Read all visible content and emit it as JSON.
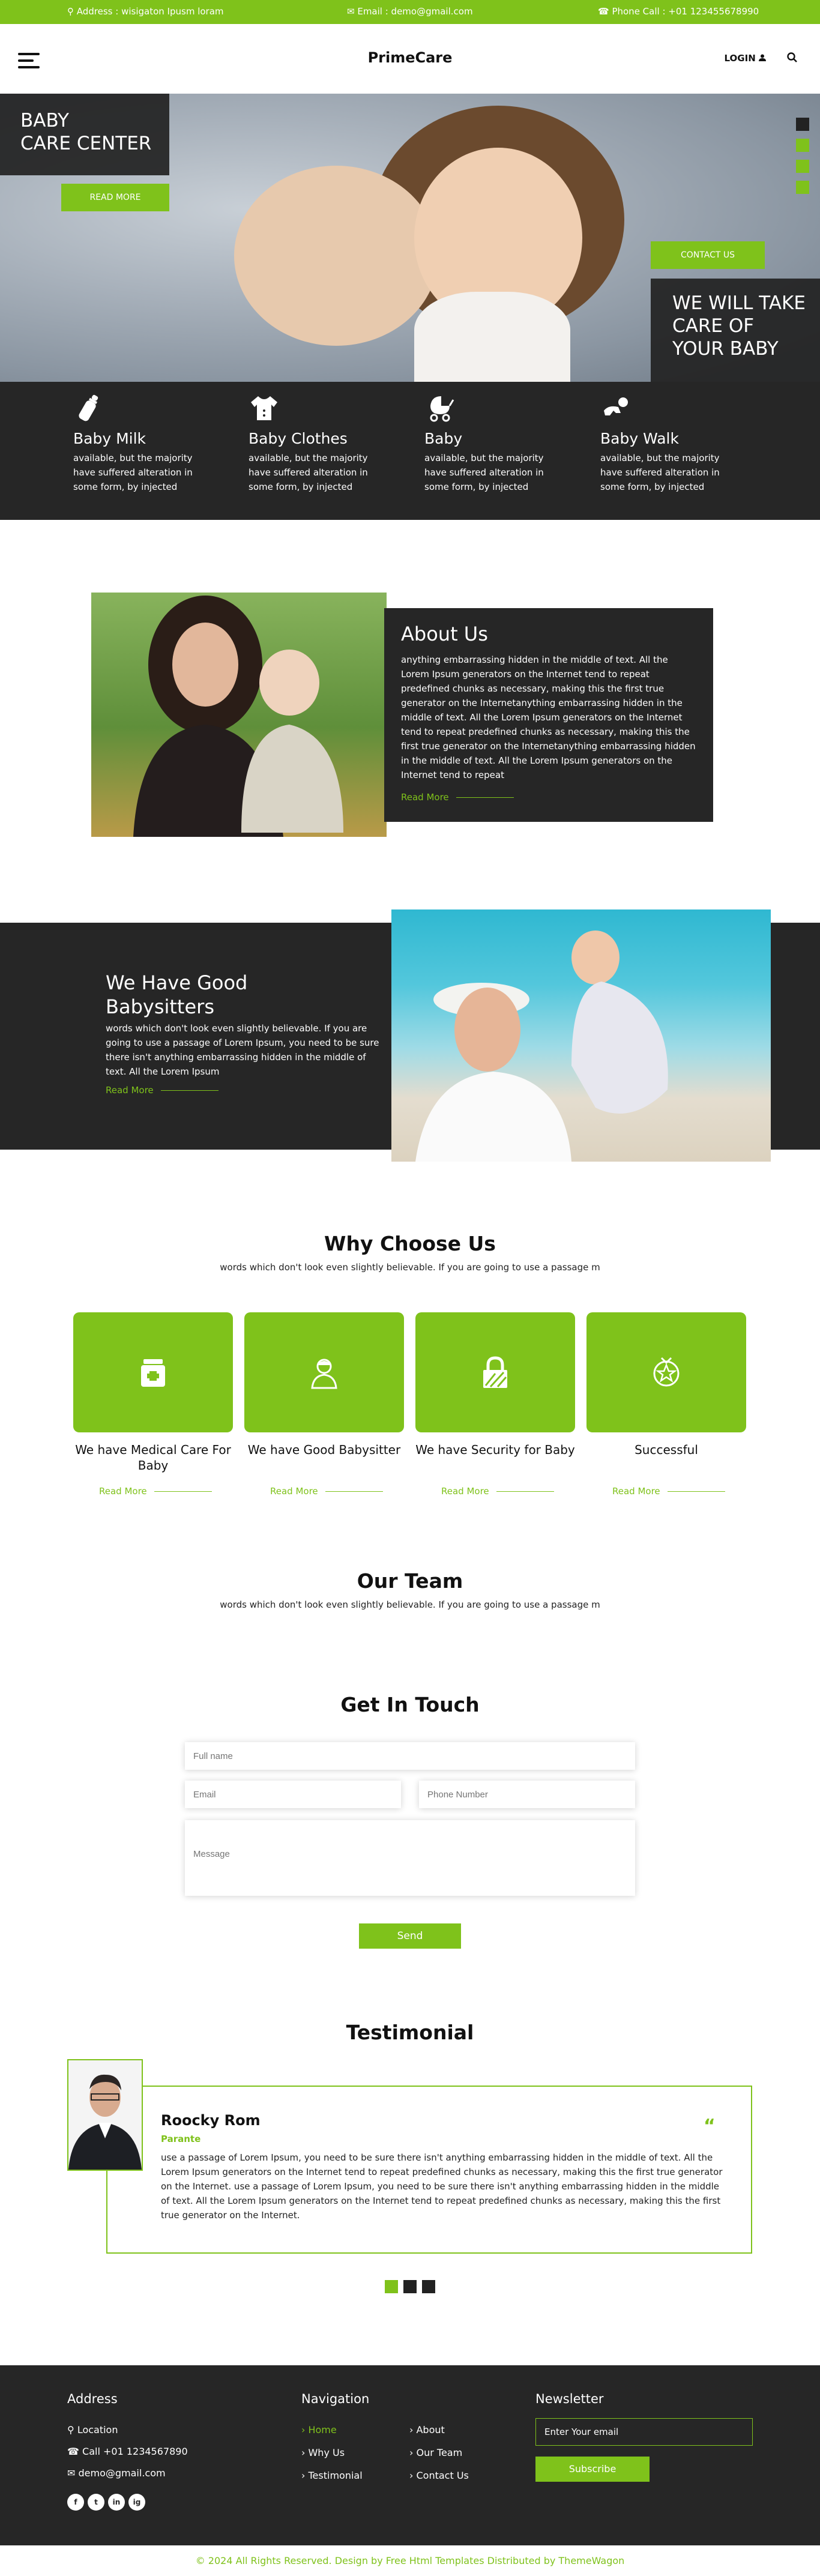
{
  "topbar": {
    "address": "Address : wisigaton Ipusm loram",
    "email": "Email : demo@gmail.com",
    "phone": "Phone Call : +01 123455678990"
  },
  "header": {
    "logo": "PrimeCare",
    "login": "LOGIN"
  },
  "hero": {
    "title_line1": "BABY",
    "title_line2": "CARE CENTER",
    "read_more": "READ MORE",
    "contact": "CONTACT US",
    "tag_line1": "WE WILL TAKE",
    "tag_line2": "CARE OF",
    "tag_line3": "YOUR BABY"
  },
  "features": [
    {
      "title": "Baby Milk",
      "text": "available, but the majority have suffered alteration in some form, by injected",
      "icon": "milk-bottle-icon"
    },
    {
      "title": "Baby Clothes",
      "text": "available, but the majority have suffered alteration in some form, by injected",
      "icon": "baby-clothes-icon"
    },
    {
      "title": "Baby",
      "text": "available, but the majority have suffered alteration in some form, by injected",
      "icon": "baby-stroller-icon"
    },
    {
      "title": "Baby Walk",
      "text": "available, but the majority have suffered alteration in some form, by injected",
      "icon": "crawling-baby-icon"
    }
  ],
  "about": {
    "title": "About Us",
    "text": "anything embarrassing hidden in the middle of text. All the Lorem Ipsum generators on the Internet tend to repeat predefined chunks as necessary, making this the first true generator on the Internetanything embarrassing hidden in the middle of text. All the Lorem Ipsum generators on the Internet tend to repeat predefined chunks as necessary, making this the first true generator on the Internetanything embarrassing hidden in the middle of text. All the Lorem Ipsum generators on the Internet tend to repeat",
    "read_more": "Read More"
  },
  "babysitters": {
    "title": "We Have Good Babysitters",
    "text": "words which don't look even slightly believable. If you are going to use a passage of Lorem Ipsum, you need to be sure there isn't anything embarrassing hidden in the middle of text. All the Lorem Ipsum",
    "read_more": "Read More"
  },
  "why": {
    "title": "Why Choose Us",
    "subtitle": "words which don't look even slightly believable. If you are going to use a passage m",
    "cards": [
      {
        "title": "We have Medical Care For Baby",
        "read_more": "Read More",
        "icon": "medicine-jar-icon"
      },
      {
        "title": "We have Good Babysitter",
        "read_more": "Read More",
        "icon": "babysitter-icon"
      },
      {
        "title": "We have Security for Baby",
        "read_more": "Read More",
        "icon": "lock-icon"
      },
      {
        "title": "Successful",
        "read_more": "Read More",
        "icon": "medal-star-icon"
      }
    ]
  },
  "team": {
    "title": "Our Team",
    "subtitle": "words which don't look even slightly believable. If you are going to use a passage m"
  },
  "contact": {
    "title": "Get In Touch",
    "fullname_placeholder": "Full name",
    "email_placeholder": "Email",
    "phone_placeholder": "Phone Number",
    "message_placeholder": "Message",
    "send": "Send"
  },
  "testimonial": {
    "title": "Testimonial",
    "name": "Roocky Rom",
    "role": "Parante",
    "quote_mark": "“",
    "text": "use a passage of Lorem Ipsum, you need to be sure there isn't anything embarrassing hidden in the middle of text. All the Lorem Ipsum generators on the Internet tend to repeat predefined chunks as necessary, making this the first true generator on the Internet. use a passage of Lorem Ipsum, you need to be sure there isn't anything embarrassing hidden in the middle of text. All the Lorem Ipsum generators on the Internet tend to repeat predefined chunks as necessary, making this the first true generator on the Internet."
  },
  "footer": {
    "address_title": "Address",
    "location": "Location",
    "call": "Call +01 1234567890",
    "email": "demo@gmail.com",
    "nav_title": "Navigation",
    "nav": [
      "Home",
      "About",
      "Why Us",
      "Our Team",
      "Testimonial",
      "Contact Us"
    ],
    "newsletter_title": "Newsletter",
    "newsletter_placeholder": "Enter Your email",
    "subscribe": "Subscribe",
    "social": [
      "f",
      "t",
      "in",
      "ig"
    ],
    "copyright": "© 2024 All Rights Reserved. Design by Free Html Templates Distributed by ThemeWagon"
  },
  "colors": {
    "accent": "#7fc21b",
    "dark": "#262626"
  }
}
